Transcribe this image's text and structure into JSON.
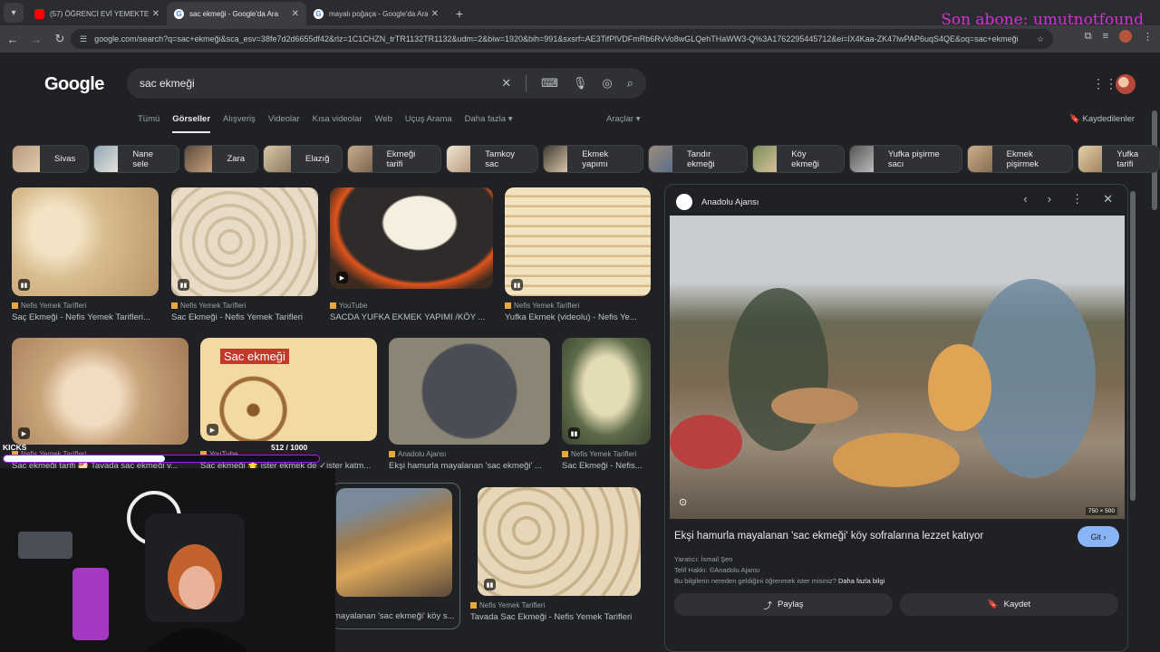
{
  "browser": {
    "tabs": [
      {
        "title": "(57) ÖĞRENCİ EVİ YEMEKTEYİZ",
        "favicon": "youtube-icon"
      },
      {
        "title": "sac ekmeği - Google'da Ara",
        "favicon": "google-icon"
      },
      {
        "title": "mayalı poğaça - Google'da Ara",
        "favicon": "google-icon"
      }
    ],
    "url": "google.com/search?q=sac+ekmeği&sca_esv=38fe7d2d6655df42&rlz=1C1CHZN_trTR1132TR1132&udm=2&biw=1920&bih=991&sxsrf=AE3TifPlVDFmRb6RvVo8wGLQehTHaWW3-Q%3A1762295445712&ei=lX4Kaa-ZK47lwPAP6uqS4QE&oq=sac+ekmeği"
  },
  "stream_overlay": {
    "last_subscriber": "Son abone: umutnotfound",
    "kicks_label": "KICKS",
    "kicks_count": "512  / 1000",
    "kicks_progress": 0.512
  },
  "google": {
    "logo": "Google",
    "query": "sac ekmeği",
    "nav_tabs": [
      "Tümü",
      "Görseller",
      "Alışveriş",
      "Videolar",
      "Kısa videolar",
      "Web",
      "Uçuş Arama",
      "Daha fazla ▾"
    ],
    "tools": "Araçlar ▾",
    "saved": "Kaydedilenler",
    "chips": [
      "Sivas",
      "Nane sele",
      "Zara",
      "Elazığ",
      "Ekmeği tarifi",
      "Tamkoy sac",
      "Ekmek yapımı",
      "Tandır ekmeği",
      "Köy ekmeği",
      "Yufka pişirme sacı",
      "Ekmek pişirmek",
      "Yufka tarifi"
    ],
    "results": [
      {
        "source": "Nefis Yemek Tarifleri",
        "caption": "Saç Ekmeği - Nefis Yemek Tarifleri..."
      },
      {
        "source": "Nefis Yemek Tarifleri",
        "caption": "Sac Ekmeği - Nefis Yemek Tarifleri"
      },
      {
        "source": "YouTube",
        "caption": "SACDA YUFKA EKMEK YAPIMI /KÖY ..."
      },
      {
        "source": "Nefis Yemek Tarifleri",
        "caption": "Yufka Ekmek (videolu) - Nefis Ye..."
      },
      {
        "source": "Nefis Yemek Tarifleri",
        "caption": "Sac ekmeği tarifi 🥙 Tavada sac ekmeği y..."
      },
      {
        "source": "YouTube",
        "caption": "Sac ekmeği 🌟 ister ekmek de ✓ister katm...",
        "overlay": "Sac ekmeği"
      },
      {
        "source": "Anadolu Ajansı",
        "caption": "Ekşi hamurla mayalanan 'sac ekmeği' ..."
      },
      {
        "source": "Nefis Yemek Tarifleri",
        "caption": "Sac Ekmeği - Nefis..."
      },
      {
        "source": "",
        "caption": "mayalanan 'sac ekmeği' köy s..."
      },
      {
        "source": "Nefis Yemek Tarifleri",
        "caption": "Tavada Sac Ekmeği - Nefis Yemek Tarifleri"
      }
    ]
  },
  "preview_panel": {
    "source": "Anadolu Ajansı",
    "dimensions": "750 × 500",
    "title": "Ekşi hamurla mayalanan 'sac ekmeği' köy sofralarına lezzet katıyor",
    "go_label": "Git ›",
    "creator": "Yaratıcı: İsmail Şen",
    "copyright": "Telif Hakkı: ©Anadolu Ajansı",
    "learn_prefix": "Bu bilgilerin nereden geldiğini öğrenmek ister misiniz? ",
    "learn_link": "Daha fazla bilgi",
    "share_label": "Paylaş",
    "save_label": "Kaydet"
  }
}
